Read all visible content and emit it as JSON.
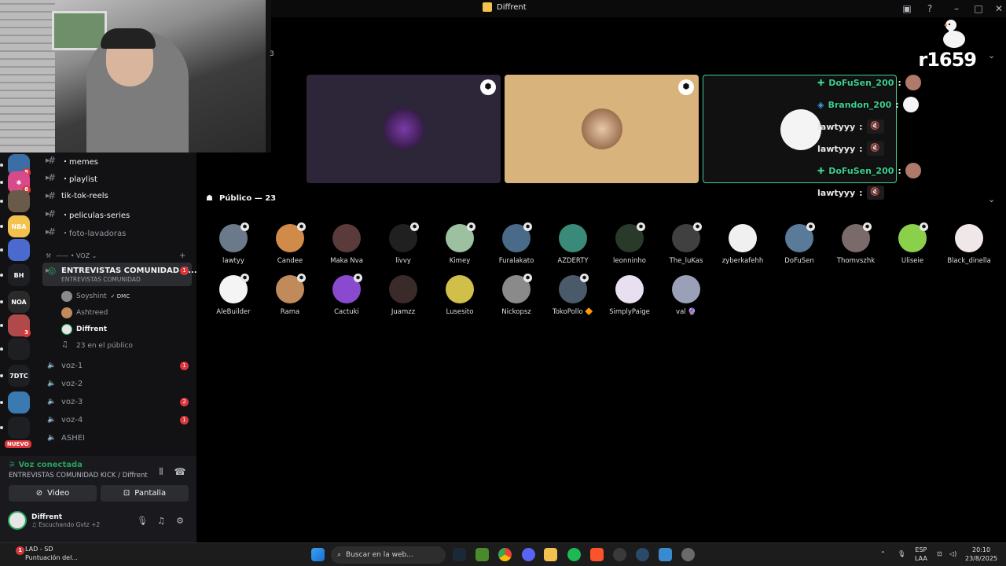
{
  "window": {
    "title": "Diffrent"
  },
  "stage": {
    "count_label": "3",
    "overlay_name": "r1659"
  },
  "overlay_chat": [
    {
      "user": "DoFuSen_200",
      "sep": ":",
      "color": "#3ecf8e",
      "kind": "avatar"
    },
    {
      "user": "Brandon_200",
      "sep": ":",
      "color": "#3ecf8e",
      "kind": "avatar"
    },
    {
      "user": "lawtyyy",
      "sep": ":",
      "color": "#e8e8e8",
      "kind": "mute"
    },
    {
      "user": "lawtyyy",
      "sep": ":",
      "color": "#e8e8e8",
      "kind": "mute"
    },
    {
      "user": "DoFuSen_200",
      "sep": ":",
      "color": "#3ecf8e",
      "kind": "avatar"
    },
    {
      "user": "lawtyyy",
      "sep": ":",
      "color": "#e8e8e8",
      "kind": "mute"
    }
  ],
  "public": {
    "label": "Público — 23"
  },
  "audience": [
    {
      "name": "lawtyy",
      "color": "#6b7a8a",
      "mod": true
    },
    {
      "name": "Candee",
      "color": "#d08a4a",
      "mod": true
    },
    {
      "name": "Maka Nva",
      "color": "#5a3a3a",
      "mod": false
    },
    {
      "name": "livvy",
      "color": "#202020",
      "mod": true
    },
    {
      "name": "Kimey",
      "color": "#9cc0a0",
      "mod": true
    },
    {
      "name": "Furalakato",
      "color": "#4a6a8a",
      "mod": true
    },
    {
      "name": "AZDERTY",
      "color": "#3a8a7a",
      "mod": false
    },
    {
      "name": "leonninho",
      "color": "#2a3a2a",
      "mod": true
    },
    {
      "name": "The_luKas",
      "color": "#404040",
      "mod": true
    },
    {
      "name": "zyberkafehh",
      "color": "#f0f0f0",
      "mod": false
    },
    {
      "name": "DoFuSen",
      "color": "#5a7a9a",
      "mod": true
    },
    {
      "name": "Thomvszhk",
      "color": "#7a6a6a",
      "mod": true
    },
    {
      "name": "Uliseie",
      "color": "#8ad04a",
      "mod": true
    },
    {
      "name": "Black_dinella",
      "color": "#f0e8e8",
      "mod": false
    },
    {
      "name": "AleBuilder",
      "color": "#f4f4f4",
      "mod": true
    },
    {
      "name": "Rama",
      "color": "#c08a5a",
      "mod": true
    },
    {
      "name": "Cactuki",
      "color": "#8a4ad0",
      "mod": true
    },
    {
      "name": "Juamzz",
      "color": "#3a2a2a",
      "mod": false
    },
    {
      "name": "Lusesito",
      "color": "#d0c04a",
      "mod": false
    },
    {
      "name": "Nickopsz",
      "color": "#8a8a8a",
      "mod": true
    },
    {
      "name": "TokoPollo 🔶",
      "color": "#4a5a6a",
      "mod": true
    },
    {
      "name": "SimplyPaige",
      "color": "#e8e0f0",
      "mod": false
    },
    {
      "name": "val 🔮",
      "color": "#9aa0b8",
      "mod": false
    }
  ],
  "channels": [
    {
      "name": "・memes",
      "type": "text",
      "bright": true
    },
    {
      "name": "・playlist",
      "type": "text",
      "bright": true
    },
    {
      "name": "tik-tok-reels",
      "type": "text",
      "bright": true
    },
    {
      "name": "・peliculas-series",
      "type": "text",
      "bright": true
    },
    {
      "name": "・foto-lavadoras",
      "type": "text",
      "bright": false
    }
  ],
  "category": {
    "label": "—— • VOZ ⌄",
    "add": "+"
  },
  "active_stage": {
    "name": "ENTREVISTAS COMUNIDAD K...",
    "sub": "ENTREVISTAS COMUNIDAD",
    "badge": "1"
  },
  "stage_users": [
    {
      "name": "Soyshint",
      "tag": "✓ DMC",
      "color": "#8a8a8a"
    },
    {
      "name": "Ashtreed",
      "tag": "",
      "color": "#c08a5a"
    },
    {
      "name": "Diffrent",
      "tag": "",
      "color": "#e6e6e6"
    },
    {
      "name": "23 en el público",
      "tag": "",
      "color": ""
    }
  ],
  "voice_channels": [
    {
      "name": "voz-1",
      "badge": "1"
    },
    {
      "name": "voz-2",
      "badge": ""
    },
    {
      "name": "voz-3",
      "badge": "2"
    },
    {
      "name": "voz-4",
      "badge": "1"
    },
    {
      "name": "ASHEI",
      "badge": ""
    }
  ],
  "voice_panel": {
    "status": "Voz conectada",
    "location": "ENTREVISTAS COMUNIDAD KICK / Diffrent",
    "video_label": "Video",
    "screen_label": "Pantalla"
  },
  "me": {
    "name": "Diffrent",
    "status": "♫ Escuchando Gvtz +2"
  },
  "servers": [
    {
      "label": "",
      "color": "#3a6ea5",
      "badge": "8"
    },
    {
      "label": "✱",
      "color": "#d94a8a",
      "badge": "8"
    },
    {
      "label": "",
      "color": "#6a5a4a",
      "badge": ""
    },
    {
      "label": "NBA",
      "color": "#f2c14e",
      "badge": ""
    },
    {
      "label": "",
      "color": "#4a6ad0",
      "badge": ""
    },
    {
      "label": "BH",
      "color": "#1e1f22",
      "badge": ""
    },
    {
      "label": "NOA",
      "color": "#2a2a2a",
      "badge": ""
    },
    {
      "label": "",
      "color": "#b04a4a",
      "badge": "3"
    },
    {
      "label": "",
      "color": "#1e1f22",
      "badge": ""
    },
    {
      "label": "7DTC",
      "color": "#1e1f22",
      "badge": ""
    },
    {
      "label": "",
      "color": "#3a7ab0",
      "badge": ""
    },
    {
      "label": "",
      "color": "#1e1f22",
      "badge": ""
    }
  ],
  "nuevo_label": "NUEVO",
  "taskbar": {
    "weather_title": "LAD - SD",
    "weather_sub": "Puntuación del...",
    "weather_badge": "1",
    "search_placeholder": "Buscar en la web...",
    "lang_top": "ESP",
    "lang_bottom": "LAA",
    "time": "20:10",
    "date": "23/8/2025"
  }
}
